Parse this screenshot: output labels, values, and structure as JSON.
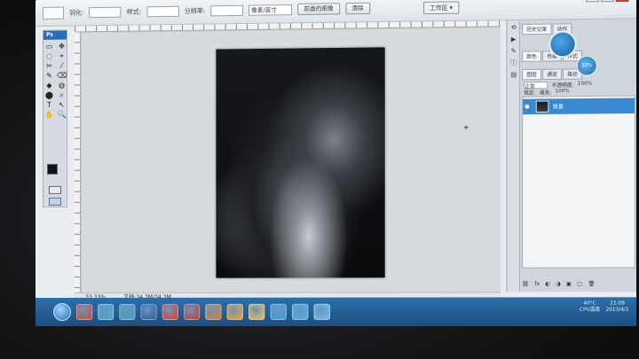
{
  "optbar": {
    "label_left": "羽化:",
    "label_style": "样式:",
    "label_resolution": "分辨率:",
    "resolution_unit": "像素/英寸",
    "front_image_button": "前面的图像",
    "clear_button": "清除",
    "workspace_button": "工作区 ▾"
  },
  "toolbox": {
    "badge": "Ps",
    "tools": [
      "▭",
      "✥",
      "◌",
      "⌖",
      "✂",
      "⁄",
      "✎",
      "⌫",
      "◆",
      "◍",
      "⬤",
      "⌕",
      "T",
      "↖",
      "✋",
      "🔍"
    ]
  },
  "document": {
    "zoom": "33.33%",
    "doc_info": "文档:34.3M/34.3M"
  },
  "panels": {
    "top_tabs": [
      "历史记录",
      "动作"
    ],
    "mid_tabs": [
      "颜色",
      "色板",
      "样式"
    ],
    "layer_tabs": [
      "图层",
      "通道",
      "路径"
    ],
    "blend_mode": "正常",
    "opacity_label": "不透明度:",
    "opacity_value": "100%",
    "lock_label": "锁定:",
    "fill_label": "填充:",
    "fill_value": "100%",
    "layer_name": "背景",
    "bottom_buttons": [
      "⛓",
      "fx",
      "◐",
      "◑",
      "▣",
      "▢",
      "🗑"
    ]
  },
  "badge": {
    "label": "52%"
  },
  "taskbar": {
    "icons": [
      "#d24a3a",
      "#4aa7d9",
      "#3fa0c7",
      "#2b5ea8",
      "#e0412e",
      "#c23a3a",
      "#e07a2e",
      "#f1a534",
      "#f0c04d",
      "#3aa0e0",
      "#4db0e8",
      "#6ac0f0"
    ],
    "temperature": "40°C",
    "temp_caption": "CPU温度",
    "time": "21:09",
    "date": "2013/4/1"
  },
  "colors": {
    "accent": "#3a88d0",
    "taskbar": "#2e6ea8"
  }
}
